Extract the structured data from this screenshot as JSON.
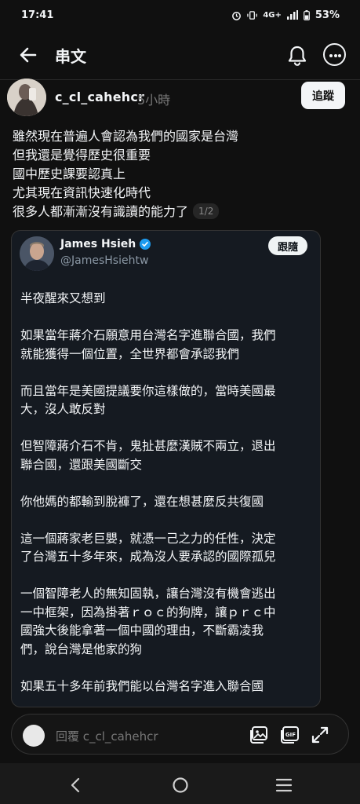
{
  "status_bar": {
    "time": "17:41",
    "network": "4G+",
    "battery": "53%"
  },
  "header": {
    "title": "串文"
  },
  "author": {
    "username": "c_cl_cahehcr",
    "time_ago": "5小時",
    "follow_label": "追蹤"
  },
  "post": {
    "lines": [
      "雖然現在普遍人會認為我們的國家是台灣",
      "但我還是覺得歷史很重要",
      "國中歷史課要認真上",
      "尤其現在資訊快速化時代",
      "很多人都漸漸沒有識讀的能力了"
    ],
    "page_indicator": "1/2"
  },
  "quote": {
    "name": "James Hsieh",
    "handle": "@JamesHsiehtw",
    "follow_label": "跟隨",
    "lines": [
      "半夜醒來又想到",
      "如果當年蔣介石願意用台灣名字進聯合國，我們",
      "就能獲得一個位置，全世界都會承認我們",
      "而且當年是美國提議要你這樣做的，當時美國最",
      "大，沒人敢反對",
      "但智障蔣介石不肯，鬼扯甚麼漢賊不兩立，退出",
      "聯合國，還跟美國斷交",
      "你他媽的都輸到脫褲了，還在想甚麼反共復國",
      "這一個蔣家老巨嬰，就憑一己之力的任性，決定",
      "了台灣五十多年來，成為沒人要承認的國際孤兒",
      "一個智障老人的無知固執，讓台灣沒有機會逃出",
      "一中框架，因為掛著ｒｏｃ的狗牌，讓ｐｒｃ中",
      "國強大後能拿著一個中國的理由，不斷霸凌我",
      "們，說台灣是他家的狗",
      "如果五十多年前我們能以台灣名字進入聯合國"
    ]
  },
  "reply": {
    "placeholder": "回覆 c_cl_cahehcr"
  },
  "icons": {
    "back": "arrow-left-icon",
    "bell": "bell-icon",
    "more": "more-icon",
    "verified": "verified-badge-icon",
    "image": "image-icon",
    "gif": "gif-icon",
    "expand": "expand-icon"
  },
  "colors": {
    "background": "#101010",
    "text": "#f3f5f7",
    "muted": "#777777",
    "card": "#151a21",
    "verified": "#1d9bf0"
  }
}
